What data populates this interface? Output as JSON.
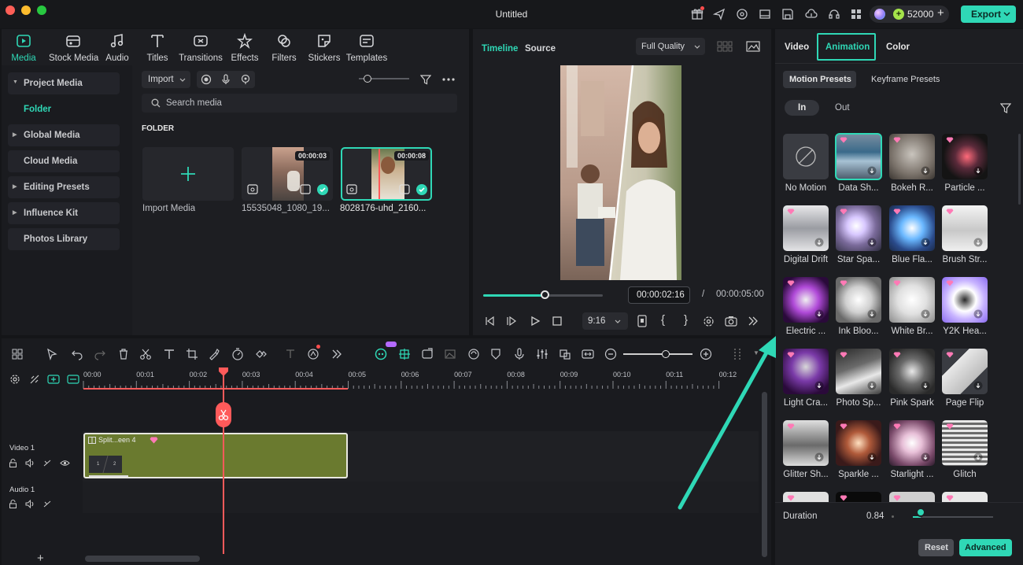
{
  "app": {
    "title": "Untitled",
    "credits": "52000",
    "export_label": "Export"
  },
  "colors": {
    "accent": "#2fd8b6",
    "playhead": "#ff5a5a",
    "clip": "#6a7a2f"
  },
  "media_tabs": [
    {
      "label": "Media",
      "icon": "media-icon",
      "active": true
    },
    {
      "label": "Stock Media",
      "icon": "stock-media-icon"
    },
    {
      "label": "Audio",
      "icon": "audio-icon"
    },
    {
      "label": "Titles",
      "icon": "titles-icon"
    },
    {
      "label": "Transitions",
      "icon": "transitions-icon"
    },
    {
      "label": "Effects",
      "icon": "effects-icon"
    },
    {
      "label": "Filters",
      "icon": "filters-icon"
    },
    {
      "label": "Stickers",
      "icon": "stickers-icon"
    },
    {
      "label": "Templates",
      "icon": "templates-icon"
    }
  ],
  "sidebar": {
    "items": [
      {
        "label": "Project Media",
        "expandable": true
      },
      {
        "label": "Folder",
        "active": true
      },
      {
        "label": "Global Media",
        "expandable": true
      },
      {
        "label": "Cloud Media"
      },
      {
        "label": "Editing Presets",
        "expandable": true
      },
      {
        "label": "Influence Kit",
        "expandable": true
      },
      {
        "label": "Photos Library"
      }
    ]
  },
  "media": {
    "import_label": "Import",
    "search_placeholder": "Search media",
    "folder_heading": "FOLDER",
    "import_media_label": "Import Media",
    "items": [
      {
        "name": "15535048_1080_19...",
        "duration": "00:00:03"
      },
      {
        "name": "8028176-uhd_2160...",
        "duration": "00:00:08",
        "selected": true
      }
    ]
  },
  "preview": {
    "tabs": [
      "Timeline",
      "Source"
    ],
    "quality": "Full Quality",
    "current_time": "00:00:02:16",
    "separator": "/",
    "total_time": "00:00:05:00",
    "aspect": "9:16",
    "progress": 0.52
  },
  "right_panel": {
    "tabs": [
      "Video",
      "Animation",
      "Color"
    ],
    "active_tab": "Animation",
    "subtabs": [
      "Motion Presets",
      "Keyframe Presets"
    ],
    "in_out": [
      "In",
      "Out"
    ],
    "presets": [
      {
        "label": "No Motion",
        "style": "none"
      },
      {
        "label": "Data Sh...",
        "style": "data",
        "selected": true
      },
      {
        "label": "Bokeh R...",
        "style": "bokeh"
      },
      {
        "label": "Particle ...",
        "style": "particle"
      },
      {
        "label": "Digital Drift",
        "style": "digital"
      },
      {
        "label": "Star Spa...",
        "style": "star"
      },
      {
        "label": "Blue Fla...",
        "style": "blue"
      },
      {
        "label": "Brush Str...",
        "style": "brush"
      },
      {
        "label": "Electric ...",
        "style": "electric"
      },
      {
        "label": "Ink Bloo...",
        "style": "ink"
      },
      {
        "label": "White Br...",
        "style": "white"
      },
      {
        "label": "Y2K Hea...",
        "style": "y2k"
      },
      {
        "label": "Light Cra...",
        "style": "lightcra"
      },
      {
        "label": "Photo Sp...",
        "style": "photo"
      },
      {
        "label": "Pink Spark",
        "style": "pink"
      },
      {
        "label": "Page Flip",
        "style": "page"
      },
      {
        "label": "Glitter Sh...",
        "style": "glitter"
      },
      {
        "label": "Sparkle ...",
        "style": "sparkle"
      },
      {
        "label": "Starlight ...",
        "style": "starlight"
      },
      {
        "label": "Glitch",
        "style": "glitch"
      }
    ],
    "duration_label": "Duration",
    "duration_value": "0.84",
    "duration_level": 0.1,
    "reset_label": "Reset",
    "advanced_label": "Advanced"
  },
  "timeline": {
    "ruler": [
      "00:00",
      "00:01",
      "00:02",
      "00:03",
      "00:04",
      "00:05",
      "00:06",
      "00:07",
      "00:08",
      "00:09",
      "00:10",
      "00:11",
      "00:12"
    ],
    "tracks": [
      {
        "label": "Video 1"
      },
      {
        "label": "Audio 1"
      }
    ],
    "clip_label": "Split...een 4",
    "clip_numbers": [
      "1",
      "2"
    ]
  }
}
